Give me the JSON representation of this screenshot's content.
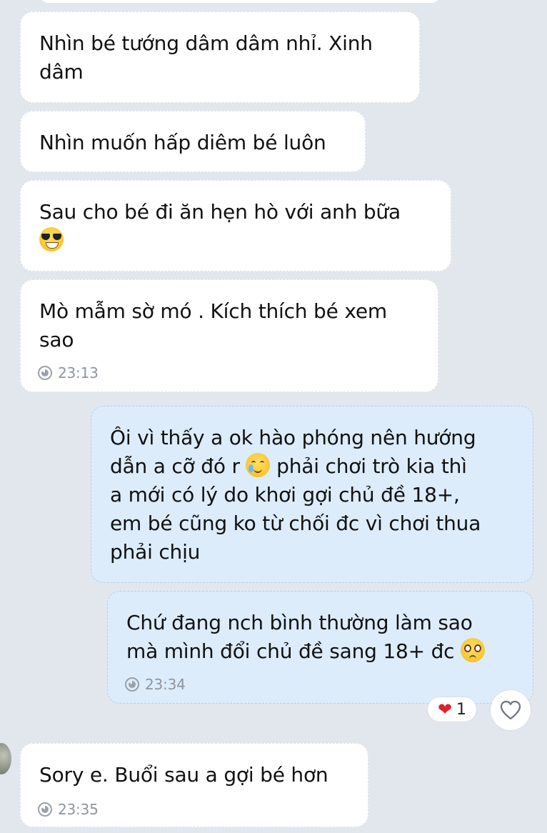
{
  "messages": [
    {
      "id": "m1",
      "dir": "in",
      "text": "Nhìn bé tướng dâm dâm nhỉ. Xinh\ndâm"
    },
    {
      "id": "m2",
      "dir": "in",
      "text": "Nhìn muốn hấp diêm bé luôn"
    },
    {
      "id": "m3",
      "dir": "in",
      "text": "Sau cho bé đi ăn hẹn hò với anh bữa",
      "emoji": "smiling-face-with-sunglasses"
    },
    {
      "id": "m4",
      "dir": "in",
      "text": "Mò mẫm sờ mó . Kích thích bé xem\nsao",
      "time": "23:13"
    },
    {
      "id": "m5",
      "dir": "out",
      "text_before": "Ôi vì thấy a ok hào phóng nên hướng\ndẫn a cỡ đó r ",
      "emoji": "smiling-face-with-tear",
      "text_after": " phải chơi trò kia thì\na mới có lý do khơi gợi chủ đề 18+,\nem bé cũng ko từ chối đc vì chơi thua\nphải chịu"
    },
    {
      "id": "m6",
      "dir": "out",
      "text": "Chứ đang nch bình thường làm sao\nmà mình đổi chủ đề sang 18+ đc ",
      "emoji": "pleading-face",
      "time": "23:34",
      "reaction": {
        "icon": "red-heart",
        "count": "1"
      }
    },
    {
      "id": "m7",
      "dir": "in",
      "text": "Sory e. Buổi sau a gợi bé hơn",
      "time": "23:35"
    }
  ],
  "icons": {
    "clock": "clock-icon",
    "heart": "heart-icon",
    "like": "heart-outline-icon"
  },
  "colors": {
    "background": "#e2e7ee",
    "incoming_bubble": "#ffffff",
    "outgoing_bubble": "#dcecfb",
    "timestamp": "#8e959e",
    "reaction_heart": "#e0212b"
  }
}
